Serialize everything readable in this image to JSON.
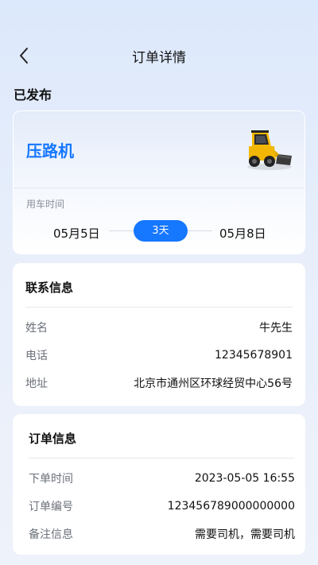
{
  "header": {
    "title": "订单详情"
  },
  "order_status": "已发布",
  "machine": {
    "name": "压路机",
    "use_time_label": "用车时间",
    "start_date": "05月5日",
    "end_date": "05月8日",
    "duration": "3天"
  },
  "contact": {
    "title": "联系信息",
    "rows": [
      {
        "label": "姓名",
        "value": "牛先生"
      },
      {
        "label": "电话",
        "value": "12345678901"
      },
      {
        "label": "地址",
        "value": "北京市通州区环球经贸中心56号"
      }
    ]
  },
  "order": {
    "title": "订单信息",
    "rows": [
      {
        "label": "下单时间",
        "value": "2023-05-05 16:55"
      },
      {
        "label": "订单编号",
        "value": "123456789000000000"
      },
      {
        "label": "备注信息",
        "value": "需要司机，需要司机"
      }
    ]
  },
  "colors": {
    "accent": "#1677ff",
    "machine_yellow": "#f2b705"
  },
  "icons": {
    "back": "chevron-left-icon",
    "machine": "skid-steer-loader-icon"
  }
}
